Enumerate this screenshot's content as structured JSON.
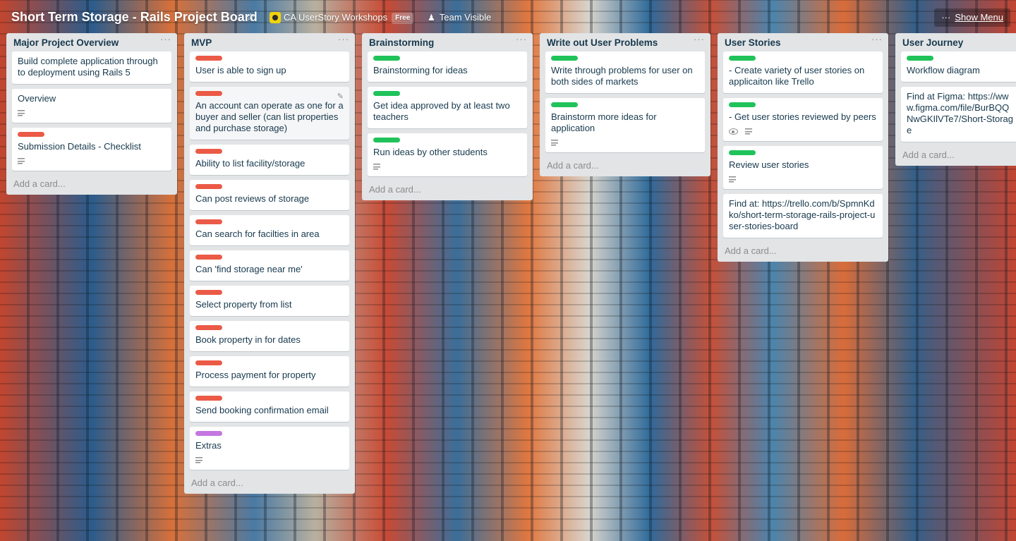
{
  "header": {
    "board_title": "Short Term Storage - Rails Project Board",
    "star": "☆",
    "org_name": "CA UserStory Workshops",
    "org_badge": "Free",
    "visibility": "Team Visible",
    "show_menu": "Show Menu",
    "menu_dots": "···"
  },
  "icons": {
    "list_menu": "···",
    "edit": "✎"
  },
  "add_card": "Add a card...",
  "colors": {
    "label_red": "#eb5a46",
    "label_green": "#1fc35a",
    "label_purple": "#c377e0",
    "list_bg": "#e2e4e6"
  },
  "lists": [
    {
      "title": "Major Project Overview",
      "cards": [
        {
          "text": "Build complete application through to deployment using Rails 5"
        },
        {
          "text": "Overview",
          "has_description": true
        },
        {
          "text": "Submission Details - Checklist",
          "label": "red",
          "has_description": true
        }
      ]
    },
    {
      "title": "MVP",
      "cards": [
        {
          "text": "User is able to sign up",
          "label": "red"
        },
        {
          "text": "An account can operate as one for a buyer and seller (can list properties and purchase storage)",
          "label": "red"
        },
        {
          "text": "Ability to list facility/storage",
          "label": "red"
        },
        {
          "text": "Can post reviews of storage",
          "label": "red"
        },
        {
          "text": "Can search for facilties in area",
          "label": "red"
        },
        {
          "text": "Can 'find storage near me'",
          "label": "red"
        },
        {
          "text": "Select property from list",
          "label": "red"
        },
        {
          "text": "Book property in for dates",
          "label": "red"
        },
        {
          "text": "Process payment for property",
          "label": "red"
        },
        {
          "text": "Send booking confirmation email",
          "label": "red"
        },
        {
          "text": "Extras",
          "label": "purple",
          "has_description": true
        }
      ]
    },
    {
      "title": "Brainstorming",
      "cards": [
        {
          "text": "Brainstorming for ideas",
          "label": "green"
        },
        {
          "text": "Get idea approved by at least two teachers",
          "label": "green"
        },
        {
          "text": "Run ideas by other students",
          "label": "green",
          "has_description": true
        }
      ]
    },
    {
      "title": "Write out User Problems",
      "cards": [
        {
          "text": "Write through problems for user on both sides of markets",
          "label": "green"
        },
        {
          "text": "Brainstorm more ideas for application",
          "label": "green",
          "has_description": true
        }
      ]
    },
    {
      "title": "User Stories",
      "cards": [
        {
          "text": "- Create variety of user stories on applicaiton like Trello",
          "label": "green"
        },
        {
          "text": "- Get user stories reviewed by peers",
          "label": "green",
          "watching": true,
          "has_description": true
        },
        {
          "text": "Review user stories",
          "label": "green",
          "has_description": true
        },
        {
          "text": "Find at: https://trello.com/b/SpmnKdko/short-term-storage-rails-project-user-stories-board"
        }
      ]
    },
    {
      "title": "User Journey",
      "cards": [
        {
          "text": "Workflow diagram",
          "label": "green"
        },
        {
          "text": "Find at Figma: https://www.figma.com/file/BurBQQNwGKIlVTe7/Short-Storage"
        }
      ]
    }
  ]
}
